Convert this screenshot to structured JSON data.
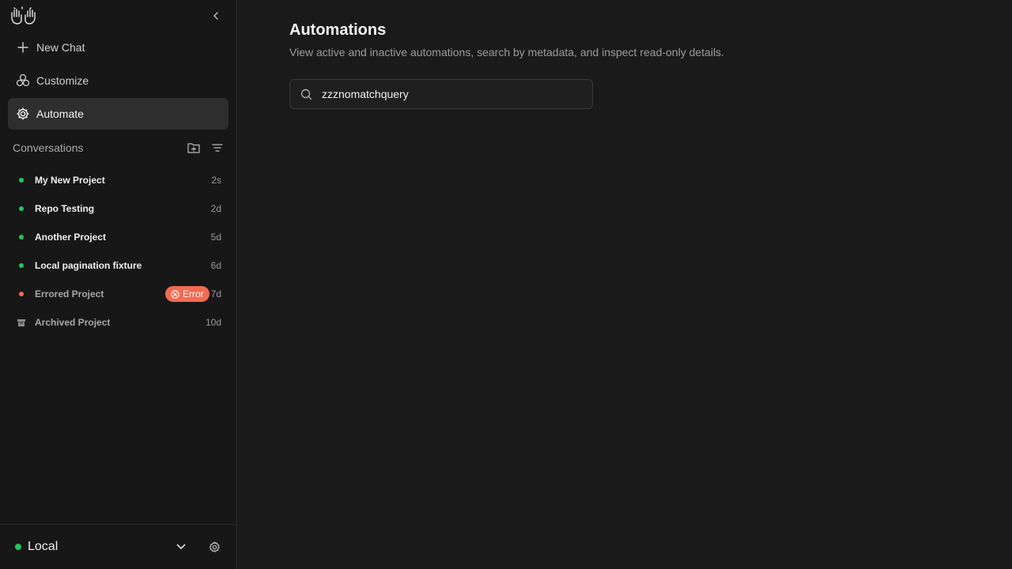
{
  "sidebar": {
    "nav": {
      "new_chat": "New Chat",
      "customize": "Customize",
      "automate": "Automate"
    },
    "conversations": {
      "title": "Conversations",
      "items": [
        {
          "name": "My New Project",
          "time": "2s",
          "status": "active"
        },
        {
          "name": "Repo Testing",
          "time": "2d",
          "status": "active"
        },
        {
          "name": "Another Project",
          "time": "5d",
          "status": "active"
        },
        {
          "name": "Local pagination fixture",
          "time": "6d",
          "status": "active"
        },
        {
          "name": "Errored Project",
          "time": "7d",
          "status": "error",
          "badge": "Error"
        },
        {
          "name": "Archived Project",
          "time": "10d",
          "status": "archived"
        }
      ]
    },
    "footer": {
      "environment": "Local"
    }
  },
  "main": {
    "title": "Automations",
    "subtitle": "View active and inactive automations, search by metadata, and inspect read-only details.",
    "search": {
      "value": "zzznomatchquery",
      "icon": "search-icon"
    }
  },
  "colors": {
    "accent_green": "#22c55e",
    "error": "#f26a52",
    "background": "#1a1a1a"
  }
}
